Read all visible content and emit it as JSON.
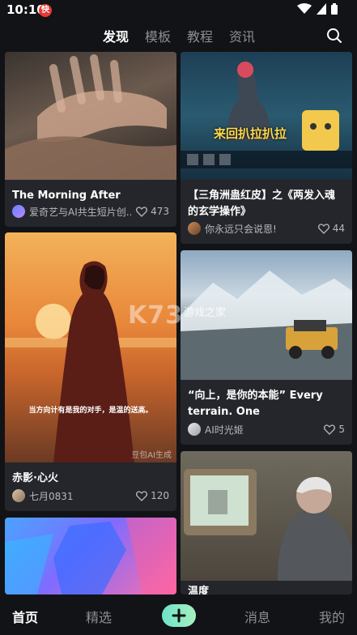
{
  "status_bar": {
    "time": "10:10",
    "badge": "快"
  },
  "top_tabs": [
    {
      "label": "发现",
      "active": true
    },
    {
      "label": "模板",
      "active": false
    },
    {
      "label": "教程",
      "active": false
    },
    {
      "label": "资讯",
      "active": false
    }
  ],
  "feed": {
    "left": [
      {
        "title": "The Morning After",
        "author": "爱奇艺与AI共生短片创...",
        "likes": "473"
      },
      {
        "title": "赤影·心火",
        "author": "七月0831",
        "likes": "120",
        "caption": "当方向计有是我的对手，是温的送高。",
        "watermark": "豆包AI生成"
      },
      {
        "title": "",
        "author": "",
        "likes": ""
      }
    ],
    "right": [
      {
        "title": "【三角洲蛊红皮】之《两发入魂的玄学操作》",
        "author": "你永远只会说恩!",
        "likes": "44",
        "caption": "来回扒拉扒拉"
      },
      {
        "title": "“向上，是你的本能” Every terrain. One",
        "author": "AI时光姬",
        "likes": "5",
        "watermark": "游戏之家"
      },
      {
        "title": "温度",
        "author": "",
        "likes": ""
      }
    ]
  },
  "center_watermark": "K73",
  "bottom_nav": [
    {
      "label": "首页",
      "active": true
    },
    {
      "label": "精选",
      "active": false
    },
    {
      "label": "消息",
      "active": false
    },
    {
      "label": "我的",
      "active": false
    }
  ],
  "colors": {
    "background": "#121316",
    "card": "#24262b",
    "accent": "#6de3c8"
  }
}
